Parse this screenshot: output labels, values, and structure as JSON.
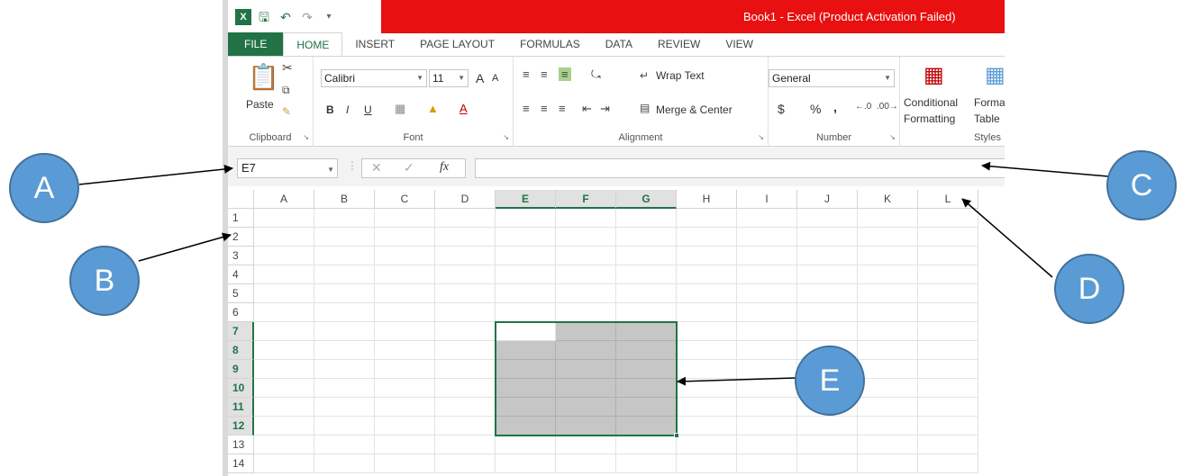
{
  "window": {
    "title": "Book1 -  Excel (Product Activation Failed)",
    "logo": "X",
    "qat": {
      "save": "save-icon",
      "undo": "undo-icon",
      "redo": "redo-icon",
      "customize": "customize-icon"
    }
  },
  "tabs": [
    "FILE",
    "HOME",
    "INSERT",
    "PAGE LAYOUT",
    "FORMULAS",
    "DATA",
    "REVIEW",
    "VIEW"
  ],
  "ribbon": {
    "clipboard": {
      "label": "Clipboard",
      "paste": "Paste"
    },
    "font": {
      "label": "Font",
      "name": "Calibri",
      "size": "11",
      "bold": "B",
      "italic": "I",
      "underline": "U",
      "grow": "A",
      "shrink": "A"
    },
    "alignment": {
      "label": "Alignment",
      "wrap_text": "Wrap Text",
      "merge_center": "Merge & Center"
    },
    "number": {
      "label": "Number",
      "format": "General",
      "currency": "$",
      "percent": "%",
      "comma": ","
    },
    "styles": {
      "label": "Styles",
      "conditional_1": "Conditional",
      "conditional_2": "Formatting",
      "format_table_1": "Format",
      "format_table_2": "Table"
    }
  },
  "formula_bar": {
    "name_box": "E7",
    "fx": "fx",
    "value": ""
  },
  "grid": {
    "columns": [
      "A",
      "B",
      "C",
      "D",
      "E",
      "F",
      "G",
      "H",
      "I",
      "J",
      "K",
      "L"
    ],
    "rows": [
      "1",
      "2",
      "3",
      "4",
      "5",
      "6",
      "7",
      "8",
      "9",
      "10",
      "11",
      "12",
      "13",
      "14"
    ],
    "selected_columns": [
      "E",
      "F",
      "G"
    ],
    "selected_rows": [
      "7",
      "8",
      "9",
      "10",
      "11",
      "12"
    ],
    "active_cell": "E7",
    "selected_range": "E7:G12"
  },
  "callouts": [
    "A",
    "B",
    "C",
    "D",
    "E"
  ],
  "colors": {
    "excel_green": "#217346",
    "title_red": "#e81010",
    "callout_fill": "#5b9bd5",
    "selection_fill": "#c6c6c6"
  }
}
